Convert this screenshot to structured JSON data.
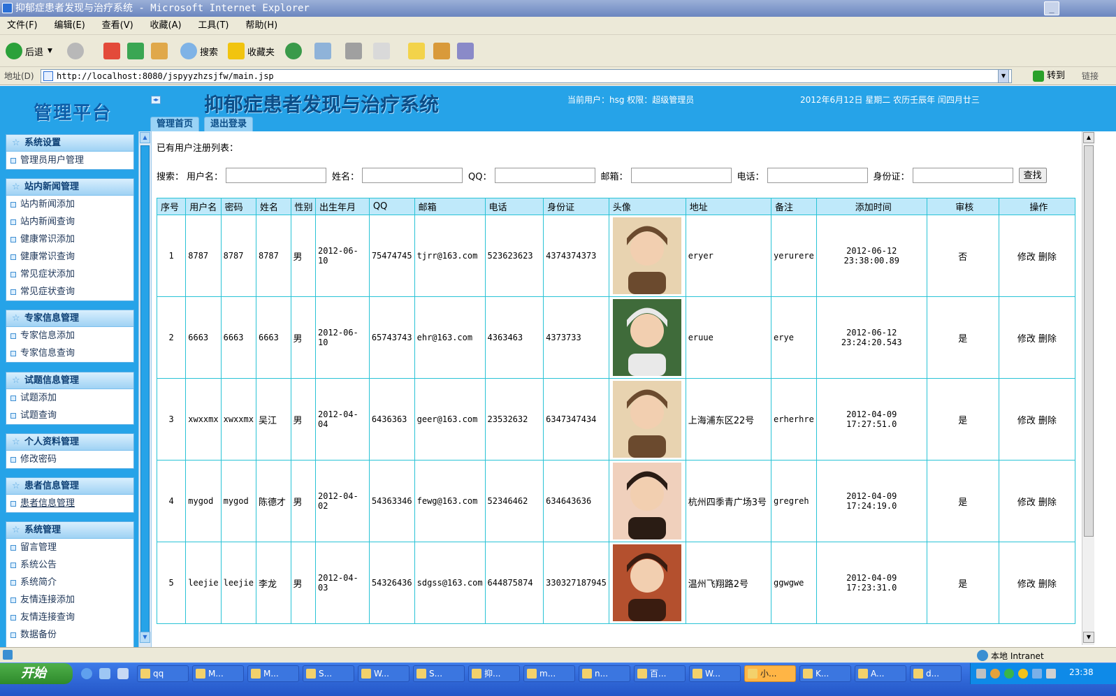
{
  "window": {
    "title": "抑郁症患者发现与治疗系统 - Microsoft Internet Explorer"
  },
  "menu": [
    "文件(F)",
    "编辑(E)",
    "查看(V)",
    "收藏(A)",
    "工具(T)",
    "帮助(H)"
  ],
  "toolbar": {
    "back": "后退",
    "search": "搜索",
    "favorites": "收藏夹"
  },
  "address": {
    "label": "地址(D)",
    "url": "http://localhost:8080/jspyyzhzsjfw/main.jsp",
    "go": "转到",
    "links": "链接"
  },
  "header": {
    "logo": "管理平台",
    "title": "抑郁症患者发现与治疗系统",
    "user_info": "当前用户：hsg 权限：超级管理员",
    "date_info": "2012年6月12日 星期二 农历壬辰年 闰四月廿三",
    "tabs": [
      "管理首页",
      "退出登录"
    ]
  },
  "sidebar": {
    "groups": [
      {
        "title": "系统设置",
        "items": [
          "管理员用户管理"
        ]
      },
      {
        "title": "站内新闻管理",
        "items": [
          "站内新闻添加",
          "站内新闻查询",
          "健康常识添加",
          "健康常识查询",
          "常见症状添加",
          "常见症状查询"
        ]
      },
      {
        "title": "专家信息管理",
        "items": [
          "专家信息添加",
          "专家信息查询"
        ]
      },
      {
        "title": "试题信息管理",
        "items": [
          "试题添加",
          "试题查询"
        ]
      },
      {
        "title": "个人资料管理",
        "items": [
          "修改密码"
        ]
      },
      {
        "title": "患者信息管理",
        "items": [
          "患者信息管理"
        ]
      },
      {
        "title": "系统管理",
        "items": [
          "留言管理",
          "系统公告",
          "系统简介",
          "友情连接添加",
          "友情连接查询",
          "数据备份"
        ]
      }
    ]
  },
  "content": {
    "list_title": "已有用户注册列表：",
    "search": {
      "prefix": "搜索：",
      "fields": [
        "用户名：",
        "姓名：",
        "QQ：",
        "邮箱：",
        "电话：",
        "身份证："
      ],
      "button": "查找"
    },
    "table": {
      "headers": [
        "序号",
        "用户名",
        "密码",
        "姓名",
        "性别",
        "出生年月",
        "QQ",
        "邮箱",
        "电话",
        "身份证",
        "头像",
        "地址",
        "备注",
        "添加时间",
        "审核",
        "操作"
      ],
      "rows": [
        {
          "no": "1",
          "username": "8787",
          "password": "8787",
          "name": "8787",
          "gender": "男",
          "birth": "2012-06-10",
          "qq": "75474745",
          "email": "tjrr@163.com",
          "phone": "523623623",
          "idcard": "4374374373",
          "address": "eryer",
          "note": "yerurere",
          "added": "2012-06-12 23:38:00.89",
          "audit": "否",
          "edit": "修改",
          "delete": "删除"
        },
        {
          "no": "2",
          "username": "6663",
          "password": "6663",
          "name": "6663",
          "gender": "男",
          "birth": "2012-06-10",
          "qq": "65743743",
          "email": "ehr@163.com",
          "phone": "4363463",
          "idcard": "4373733",
          "address": "eruue",
          "note": "erye",
          "added": "2012-06-12 23:24:20.543",
          "audit": "是",
          "edit": "修改",
          "delete": "删除"
        },
        {
          "no": "3",
          "username": "xwxxmx",
          "password": "xwxxmx",
          "name": "吴江",
          "gender": "男",
          "birth": "2012-04-04",
          "qq": "6436363",
          "email": "geer@163.com",
          "phone": "23532632",
          "idcard": "6347347434",
          "address": "上海浦东区22号",
          "note": "erherhre",
          "added": "2012-04-09 17:27:51.0",
          "audit": "是",
          "edit": "修改",
          "delete": "删除"
        },
        {
          "no": "4",
          "username": "mygod",
          "password": "mygod",
          "name": "陈德才",
          "gender": "男",
          "birth": "2012-04-02",
          "qq": "54363346",
          "email": "fewg@163.com",
          "phone": "52346462",
          "idcard": "634643636",
          "address": "杭州四季青广场3号",
          "note": "gregreh",
          "added": "2012-04-09 17:24:19.0",
          "audit": "是",
          "edit": "修改",
          "delete": "删除"
        },
        {
          "no": "5",
          "username": "leejie",
          "password": "leejie",
          "name": "李龙",
          "gender": "男",
          "birth": "2012-04-03",
          "qq": "54326436",
          "email": "sdgss@163.com",
          "phone": "644875874",
          "idcard": "330327187945",
          "address": "温州飞翔路2号",
          "note": "ggwgwe",
          "added": "2012-04-09 17:23:31.0",
          "audit": "是",
          "edit": "修改",
          "delete": "删除"
        }
      ]
    }
  },
  "statusbar": {
    "zone": "本地 Intranet"
  },
  "taskbar": {
    "start": "开始",
    "tasks": [
      "qq",
      "M...",
      "M...",
      "S...",
      "W...",
      "S...",
      "抑...",
      "m...",
      "n...",
      "百...",
      "W...",
      "小...",
      "K...",
      "A...",
      "d..."
    ],
    "clock": "23:38"
  },
  "colors": {
    "header_blue": "#26a3e8",
    "table_border": "#29c3d6",
    "table_head": "#bfe9fa"
  },
  "icons": {
    "back": "back-arrow-icon",
    "forward": "forward-arrow-icon",
    "stop": "stop-icon",
    "refresh": "refresh-icon",
    "home": "home-icon",
    "search": "search-icon",
    "favorites": "star-icon",
    "history": "history-icon",
    "mail": "mail-icon",
    "print": "printer-icon"
  }
}
